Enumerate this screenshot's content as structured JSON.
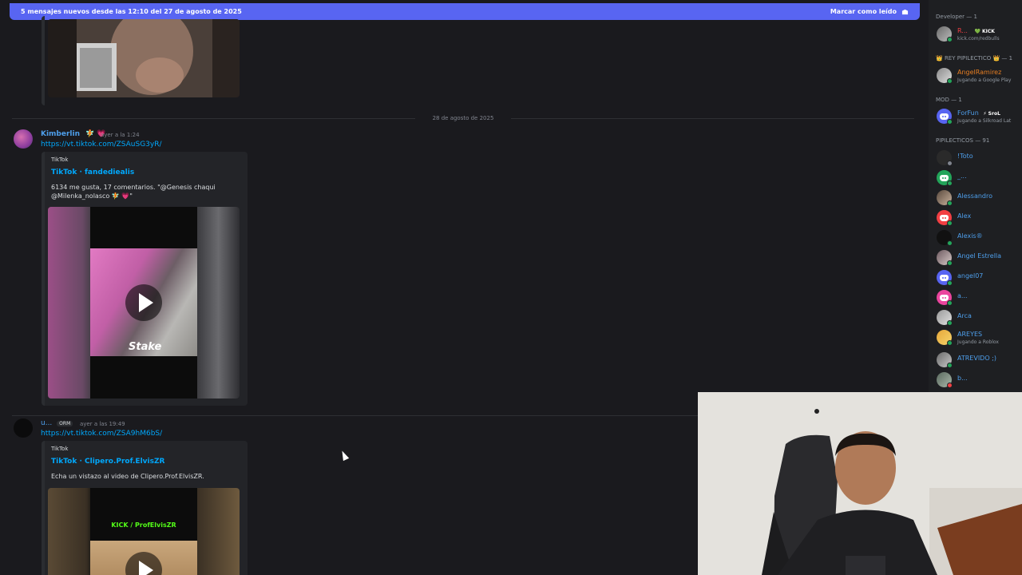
{
  "new_messages_bar": {
    "text": "5 mensajes nuevos desde las 12:10 del 27 de agosto de 2025",
    "mark_read_label": "Marcar como leído"
  },
  "date_separator": "28 de agosto de 2025",
  "messages": [
    {
      "username": "Kimberlin",
      "username_emoji": "🧚 💗",
      "timestamp": "ayer a la 1:24",
      "link": "https://vt.tiktok.com/ZSAuSG3yR/",
      "embed": {
        "provider": "TikTok",
        "title": "TikTok · fandediealis",
        "description_line1": "6134 me gusta, 17 comentarios. \"@Genesis chaqui",
        "description_line2": "@Milenka_nolasco 🧚 💗\"",
        "video_overlay_text": "Stake"
      }
    },
    {
      "username": "u...",
      "tag": "ORM",
      "timestamp": "ayer a las 19:49",
      "link": "https://vt.tiktok.com/ZSA9hM6bS/",
      "embed": {
        "provider": "TikTok",
        "title": "TikTok · Clipero.Prof.ElvisZR",
        "description": "Echa un vistazo al video de Clipero.Prof.ElvisZR.",
        "video_overlay_text": "KICK / ProfElvisZR"
      }
    }
  ],
  "members": {
    "categories": {
      "developer": "Developer — 1",
      "rey": "👑 REY PIPILECTICO 👑 — 1",
      "mod": "MOD — 1",
      "pipilecticos": "PIPILECTICOS — 91"
    },
    "developer": [
      {
        "name": "R...",
        "badge": "💚 KICK",
        "activity": "kick.com/redbulls",
        "color": "#f23f43"
      }
    ],
    "rey": [
      {
        "name": "AngelRamirez",
        "activity": "Jugando a Google Play",
        "color": "#e67e22"
      }
    ],
    "mod": [
      {
        "name": "ForFun",
        "badge": "⚡ SroL",
        "activity": "Jugando a Silkroad Lat",
        "color": "#4e9fec"
      }
    ],
    "pipilecticos": [
      {
        "name": "!Toto",
        "activity": ""
      },
      {
        "name": "_...",
        "activity": ""
      },
      {
        "name": "Alessandro",
        "activity": ""
      },
      {
        "name": "Alex",
        "activity": ""
      },
      {
        "name": "Alexis®",
        "activity": ""
      },
      {
        "name": "Angel Estrella",
        "activity": ""
      },
      {
        "name": "angel07",
        "activity": ""
      },
      {
        "name": "a...",
        "activity": ""
      },
      {
        "name": "Arca",
        "activity": ""
      },
      {
        "name": "AREYES",
        "activity": "Jugando a Roblox"
      },
      {
        "name": "ATREVIDO ;)",
        "activity": ""
      },
      {
        "name": "b...",
        "activity": ""
      }
    ],
    "pipilecticos_color": "#4e9fec"
  }
}
